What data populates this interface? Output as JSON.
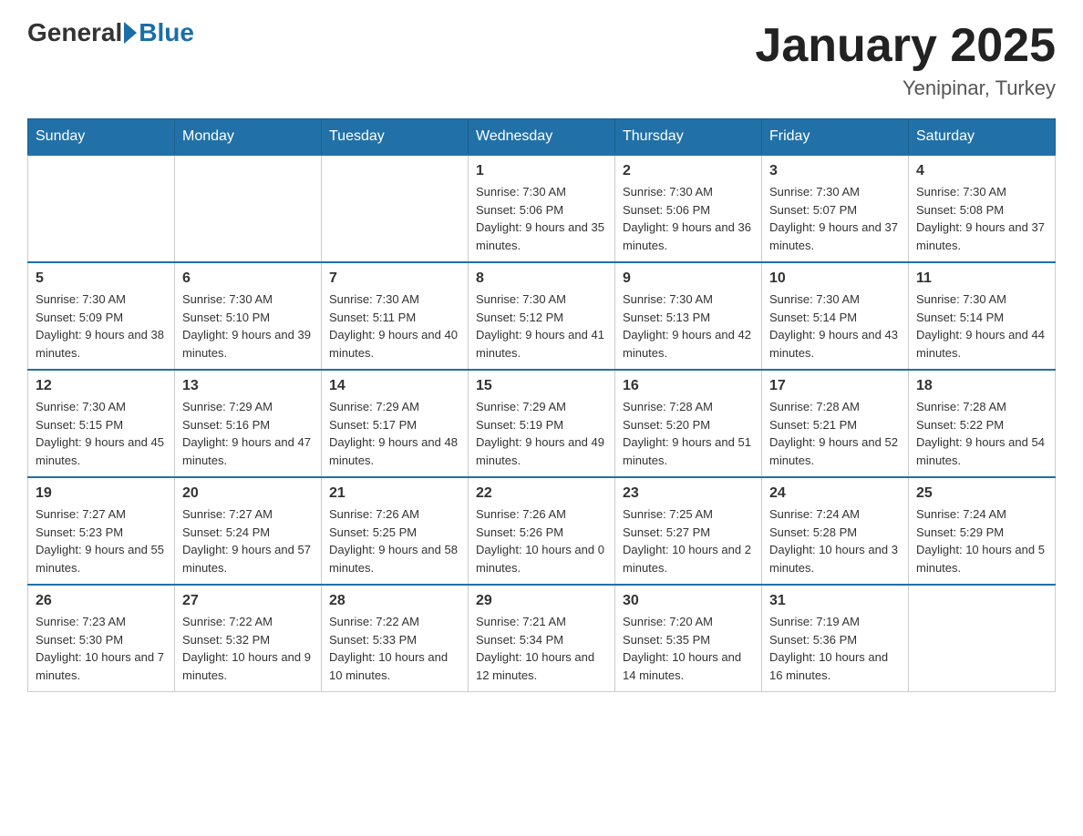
{
  "header": {
    "logo_general": "General",
    "logo_blue": "Blue",
    "title": "January 2025",
    "subtitle": "Yenipinar, Turkey"
  },
  "days_of_week": [
    "Sunday",
    "Monday",
    "Tuesday",
    "Wednesday",
    "Thursday",
    "Friday",
    "Saturday"
  ],
  "weeks": [
    [
      {
        "day": "",
        "info": ""
      },
      {
        "day": "",
        "info": ""
      },
      {
        "day": "",
        "info": ""
      },
      {
        "day": "1",
        "info": "Sunrise: 7:30 AM\nSunset: 5:06 PM\nDaylight: 9 hours and 35 minutes."
      },
      {
        "day": "2",
        "info": "Sunrise: 7:30 AM\nSunset: 5:06 PM\nDaylight: 9 hours and 36 minutes."
      },
      {
        "day": "3",
        "info": "Sunrise: 7:30 AM\nSunset: 5:07 PM\nDaylight: 9 hours and 37 minutes."
      },
      {
        "day": "4",
        "info": "Sunrise: 7:30 AM\nSunset: 5:08 PM\nDaylight: 9 hours and 37 minutes."
      }
    ],
    [
      {
        "day": "5",
        "info": "Sunrise: 7:30 AM\nSunset: 5:09 PM\nDaylight: 9 hours and 38 minutes."
      },
      {
        "day": "6",
        "info": "Sunrise: 7:30 AM\nSunset: 5:10 PM\nDaylight: 9 hours and 39 minutes."
      },
      {
        "day": "7",
        "info": "Sunrise: 7:30 AM\nSunset: 5:11 PM\nDaylight: 9 hours and 40 minutes."
      },
      {
        "day": "8",
        "info": "Sunrise: 7:30 AM\nSunset: 5:12 PM\nDaylight: 9 hours and 41 minutes."
      },
      {
        "day": "9",
        "info": "Sunrise: 7:30 AM\nSunset: 5:13 PM\nDaylight: 9 hours and 42 minutes."
      },
      {
        "day": "10",
        "info": "Sunrise: 7:30 AM\nSunset: 5:14 PM\nDaylight: 9 hours and 43 minutes."
      },
      {
        "day": "11",
        "info": "Sunrise: 7:30 AM\nSunset: 5:14 PM\nDaylight: 9 hours and 44 minutes."
      }
    ],
    [
      {
        "day": "12",
        "info": "Sunrise: 7:30 AM\nSunset: 5:15 PM\nDaylight: 9 hours and 45 minutes."
      },
      {
        "day": "13",
        "info": "Sunrise: 7:29 AM\nSunset: 5:16 PM\nDaylight: 9 hours and 47 minutes."
      },
      {
        "day": "14",
        "info": "Sunrise: 7:29 AM\nSunset: 5:17 PM\nDaylight: 9 hours and 48 minutes."
      },
      {
        "day": "15",
        "info": "Sunrise: 7:29 AM\nSunset: 5:19 PM\nDaylight: 9 hours and 49 minutes."
      },
      {
        "day": "16",
        "info": "Sunrise: 7:28 AM\nSunset: 5:20 PM\nDaylight: 9 hours and 51 minutes."
      },
      {
        "day": "17",
        "info": "Sunrise: 7:28 AM\nSunset: 5:21 PM\nDaylight: 9 hours and 52 minutes."
      },
      {
        "day": "18",
        "info": "Sunrise: 7:28 AM\nSunset: 5:22 PM\nDaylight: 9 hours and 54 minutes."
      }
    ],
    [
      {
        "day": "19",
        "info": "Sunrise: 7:27 AM\nSunset: 5:23 PM\nDaylight: 9 hours and 55 minutes."
      },
      {
        "day": "20",
        "info": "Sunrise: 7:27 AM\nSunset: 5:24 PM\nDaylight: 9 hours and 57 minutes."
      },
      {
        "day": "21",
        "info": "Sunrise: 7:26 AM\nSunset: 5:25 PM\nDaylight: 9 hours and 58 minutes."
      },
      {
        "day": "22",
        "info": "Sunrise: 7:26 AM\nSunset: 5:26 PM\nDaylight: 10 hours and 0 minutes."
      },
      {
        "day": "23",
        "info": "Sunrise: 7:25 AM\nSunset: 5:27 PM\nDaylight: 10 hours and 2 minutes."
      },
      {
        "day": "24",
        "info": "Sunrise: 7:24 AM\nSunset: 5:28 PM\nDaylight: 10 hours and 3 minutes."
      },
      {
        "day": "25",
        "info": "Sunrise: 7:24 AM\nSunset: 5:29 PM\nDaylight: 10 hours and 5 minutes."
      }
    ],
    [
      {
        "day": "26",
        "info": "Sunrise: 7:23 AM\nSunset: 5:30 PM\nDaylight: 10 hours and 7 minutes."
      },
      {
        "day": "27",
        "info": "Sunrise: 7:22 AM\nSunset: 5:32 PM\nDaylight: 10 hours and 9 minutes."
      },
      {
        "day": "28",
        "info": "Sunrise: 7:22 AM\nSunset: 5:33 PM\nDaylight: 10 hours and 10 minutes."
      },
      {
        "day": "29",
        "info": "Sunrise: 7:21 AM\nSunset: 5:34 PM\nDaylight: 10 hours and 12 minutes."
      },
      {
        "day": "30",
        "info": "Sunrise: 7:20 AM\nSunset: 5:35 PM\nDaylight: 10 hours and 14 minutes."
      },
      {
        "day": "31",
        "info": "Sunrise: 7:19 AM\nSunset: 5:36 PM\nDaylight: 10 hours and 16 minutes."
      },
      {
        "day": "",
        "info": ""
      }
    ]
  ]
}
